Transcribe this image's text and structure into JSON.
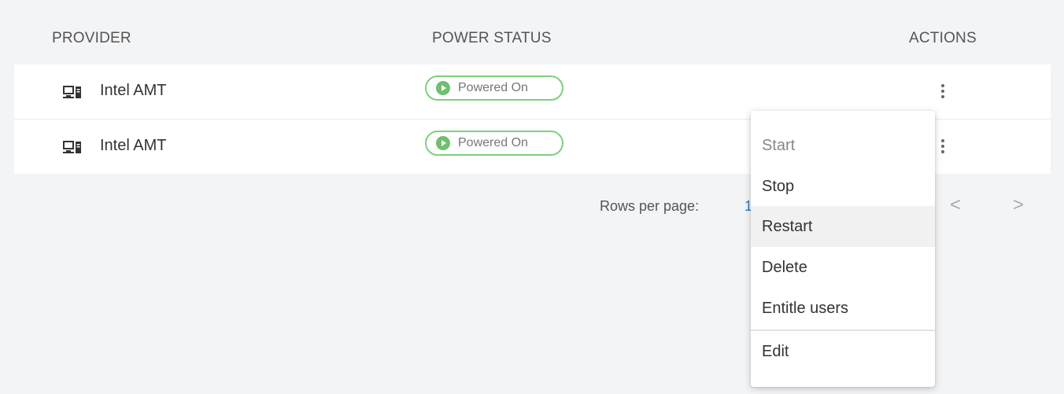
{
  "table": {
    "headers": {
      "provider": "PROVIDER",
      "power_status": "POWER STATUS",
      "actions": "ACTIONS"
    },
    "rows": [
      {
        "provider": "Intel AMT",
        "power_status": "Powered On"
      },
      {
        "provider": "Intel AMT",
        "power_status": "Powered On"
      }
    ]
  },
  "pagination": {
    "rows_per_page_label": "Rows per page:",
    "rows_per_page_value": "1",
    "prev": "<",
    "next": ">"
  },
  "actions_menu": {
    "items": [
      "Start",
      "Stop",
      "Restart",
      "Delete",
      "Entitle users",
      "Edit"
    ],
    "disabled": "Start",
    "highlighted": "Restart"
  },
  "colors": {
    "status_green": "#7dd07d",
    "link_blue": "#2a7bbd"
  }
}
